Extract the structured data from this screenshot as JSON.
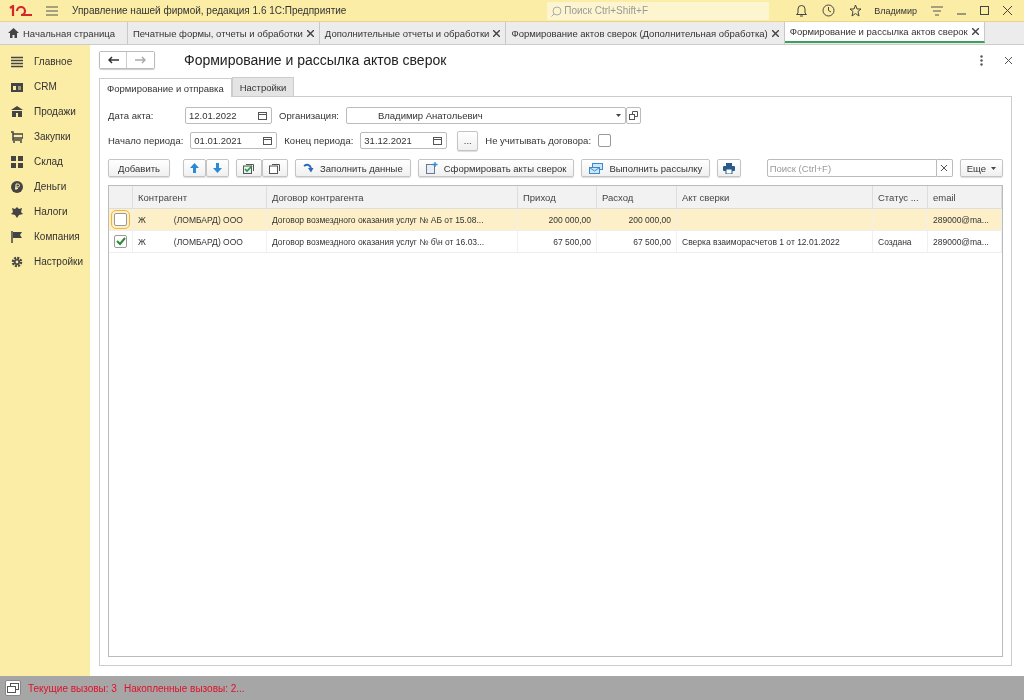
{
  "app": {
    "title": "Управление нашей фирмой, редакция 1.6 1С:Предприятие",
    "search_placeholder": "Поиск Ctrl+Shift+F",
    "user": "Владимир"
  },
  "open_tabs": [
    {
      "label": "Начальная страница",
      "kind": "home",
      "selected": false
    },
    {
      "label": "Печатные формы, отчеты и обработки",
      "kind": "closable",
      "selected": false
    },
    {
      "label": "Дополнительные отчеты и обработки",
      "kind": "closable",
      "selected": false
    },
    {
      "label": "Формирование актов сверок (Дополнительная обработка)",
      "kind": "closable",
      "selected": false
    },
    {
      "label": "Формирование и рассылка актов сверок",
      "kind": "closable",
      "selected": true
    }
  ],
  "sidebar": {
    "items": [
      {
        "label": "Главное",
        "kind": "lines"
      },
      {
        "label": "CRM",
        "kind": "card"
      },
      {
        "label": "Продажи",
        "kind": "shop"
      },
      {
        "label": "Закупки",
        "kind": "cart"
      },
      {
        "label": "Склад",
        "kind": "grid"
      },
      {
        "label": "Деньги",
        "kind": "coin"
      },
      {
        "label": "Налоги",
        "kind": "emblem"
      },
      {
        "label": "Компания",
        "kind": "flag"
      },
      {
        "label": "Настройки",
        "kind": "gear"
      }
    ]
  },
  "form": {
    "title": "Формирование и рассылка актов сверок",
    "tabs": [
      {
        "label": "Формирование и отправка",
        "selected": true
      },
      {
        "label": "Настройки",
        "selected": false
      }
    ],
    "act_date": {
      "label": "Дата акта:",
      "value": "12.01.2022"
    },
    "organization": {
      "label": "Организация:",
      "value": "Владимир Анатольевич"
    },
    "period_start": {
      "label": "Начало периода:",
      "value": "01.01.2021"
    },
    "period_end": {
      "label": "Конец периода:",
      "value": "31.12.2021"
    },
    "period_button": "...",
    "ignore_contracts": {
      "label": "Не учитывать договора:",
      "checked": false
    },
    "toolbar": {
      "add": "Добавить",
      "fill": "Заполнить данные",
      "generate": "Сформировать акты сверок",
      "send": "Выполнить рассылку",
      "search_placeholder": "Поиск (Ctrl+F)",
      "more": "Еще"
    },
    "table": {
      "columns": [
        "Контрагент",
        "Договор контрагента",
        "Приход",
        "Расход",
        "Акт сверки",
        "Статус ...",
        "email"
      ],
      "rows": [
        {
          "checked": false,
          "selected": true,
          "name_start": "Ж",
          "name_end": "(ЛОМБАРД) ООО",
          "contract": "Договор возмездного оказания услуг № АБ от 15.08...",
          "income": "200 000,00",
          "expense": "200 000,00",
          "act": "",
          "status": "",
          "email": "289000@ma..."
        },
        {
          "checked": true,
          "selected": false,
          "name_start": "Ж",
          "name_end": "(ЛОМБАРД) ООО",
          "contract": "Договор возмездного оказания услуг № б\\н от 16.03...",
          "income": "67 500,00",
          "expense": "67 500,00",
          "act": "Сверка взаиморасчетов 1 от 12.01.2022",
          "status": "Создана",
          "email": "289000@ma..."
        }
      ]
    }
  },
  "status_bar": {
    "current": "Текущие вызовы: 3",
    "accumulated": "Накопленные вызовы: 2..."
  }
}
